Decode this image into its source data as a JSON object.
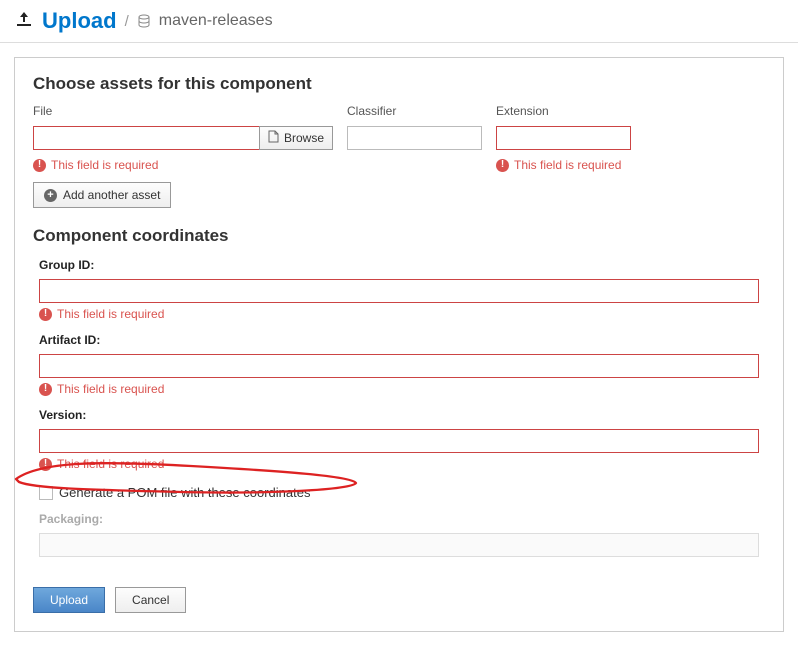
{
  "header": {
    "title": "Upload",
    "separator": "/",
    "repo": "maven-releases"
  },
  "section": {
    "assetsTitle": "Choose assets for this component",
    "coordTitle": "Component coordinates"
  },
  "labels": {
    "file": "File",
    "classifier": "Classifier",
    "extension": "Extension",
    "groupId": "Group ID:",
    "artifactId": "Artifact ID:",
    "version": "Version:",
    "packaging": "Packaging:",
    "generatePom": "Generate a POM file with these coordinates"
  },
  "buttons": {
    "browse": "Browse",
    "addAsset": "Add another asset",
    "upload": "Upload",
    "cancel": "Cancel"
  },
  "errors": {
    "required": "This field is required"
  }
}
